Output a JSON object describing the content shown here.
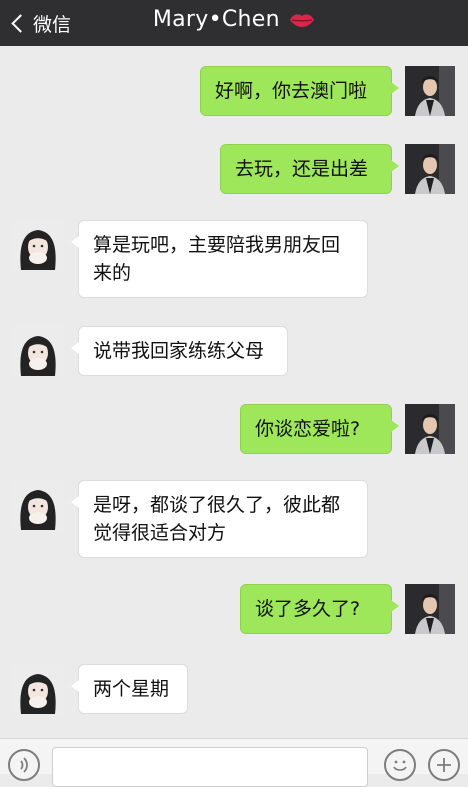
{
  "header": {
    "back_label": "微信",
    "title": "Mary•Chen"
  },
  "messages": [
    {
      "side": "out",
      "text": "好啊，你去澳门啦"
    },
    {
      "side": "out",
      "text": "去玩，还是出差"
    },
    {
      "side": "in",
      "text": "算是玩吧，主要陪我男朋友回来的"
    },
    {
      "side": "in",
      "text": "说带我回家练练父母"
    },
    {
      "side": "out",
      "text": "你谈恋爱啦?"
    },
    {
      "side": "in",
      "text": "是呀，都谈了很久了，彼此都觉得很适合对方"
    },
    {
      "side": "out",
      "text": "谈了多久了?"
    },
    {
      "side": "in",
      "text": "两个星期"
    }
  ],
  "icons": {
    "back": "chevron-left-icon",
    "title_emoji": "lips-icon",
    "voice": "voice-icon",
    "emoji": "emoji-icon",
    "plus": "plus-icon"
  },
  "colors": {
    "header_bg": "#2f2f31",
    "chat_bg": "#ebebeb",
    "out_bubble": "#9ee65a",
    "in_bubble": "#ffffff"
  }
}
